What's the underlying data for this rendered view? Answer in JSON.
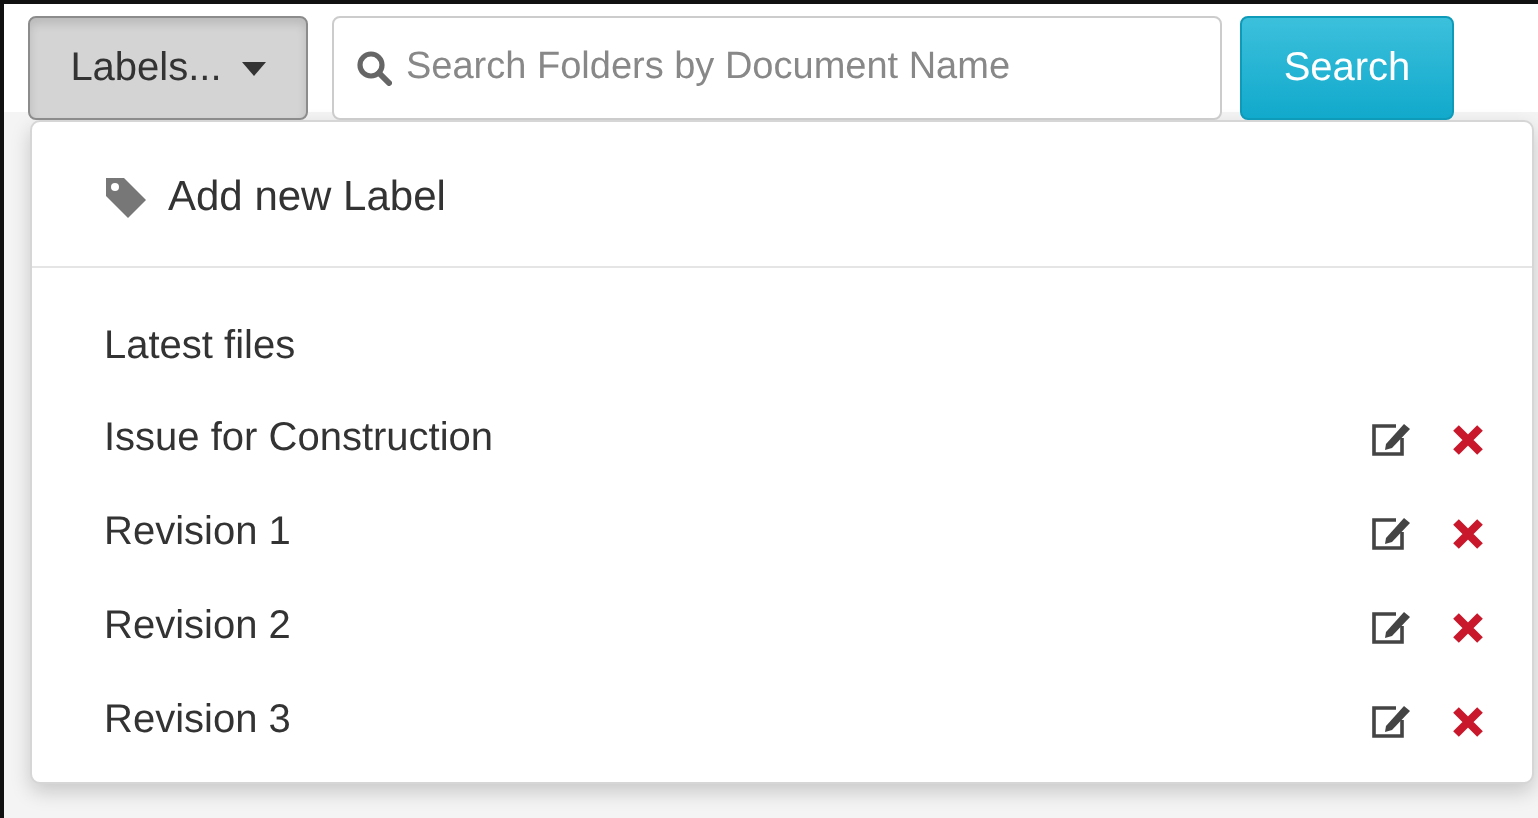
{
  "toolbar": {
    "labels_button": {
      "label": "Labels...",
      "expanded": true
    },
    "search": {
      "placeholder": "Search Folders by Document Name"
    },
    "search_button": "Search"
  },
  "labels_menu": {
    "add_item": "Add new Label",
    "section_header": "Latest files",
    "items": [
      {
        "label": "Issue for Construction"
      },
      {
        "label": "Revision 1"
      },
      {
        "label": "Revision 2"
      },
      {
        "label": "Revision 3"
      }
    ]
  }
}
